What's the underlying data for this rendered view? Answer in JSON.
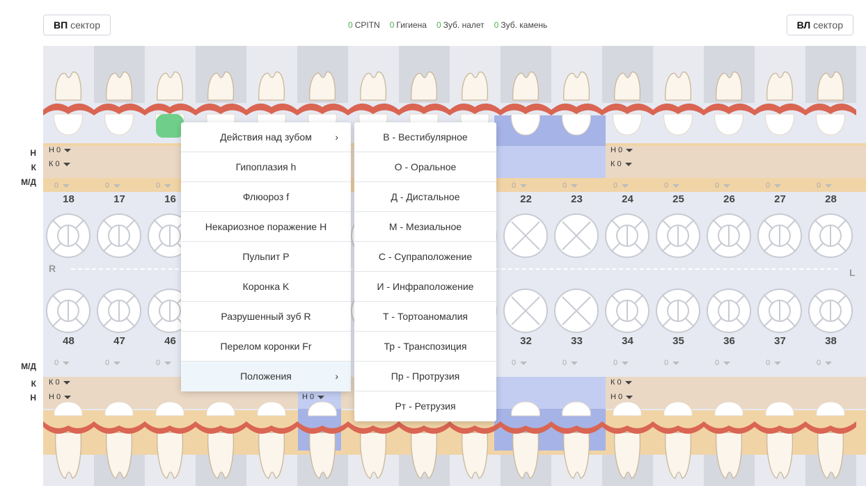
{
  "header": {
    "left_button": {
      "bold": "ВП",
      "text": "сектор"
    },
    "right_button": {
      "bold": "ВЛ",
      "text": "сектор"
    },
    "indicators": [
      {
        "count": "0",
        "label": "CPITN"
      },
      {
        "count": "0",
        "label": "Гигиена"
      },
      {
        "count": "0",
        "label": "Зуб. налет"
      },
      {
        "count": "0",
        "label": "Зуб. камень"
      }
    ]
  },
  "row_labels": {
    "upper_h": "Н",
    "upper_k": "К",
    "upper_md": "М/Д",
    "lower_md": "М/Д",
    "lower_k": "К",
    "lower_h": "Н"
  },
  "upper_numbers": [
    "18",
    "17",
    "16",
    "",
    "",
    "",
    "",
    "",
    "",
    "22",
    "23",
    "24",
    "25",
    "26",
    "27",
    "28"
  ],
  "lower_numbers": [
    "48",
    "47",
    "46",
    "",
    "",
    "",
    "",
    "",
    "",
    "32",
    "33",
    "34",
    "35",
    "36",
    "37",
    "38"
  ],
  "side_labels": {
    "right": "R",
    "left": "L"
  },
  "selectors": {
    "h0": "Н 0",
    "k0": "К 0",
    "md0": "0"
  },
  "context_menu": {
    "items": [
      {
        "label": "Действия над зубом",
        "arrow": "›"
      },
      {
        "label": "Гипоплазия h"
      },
      {
        "label": "Флюороз f"
      },
      {
        "label": "Некариозное поражение H"
      },
      {
        "label": "Пульпит P"
      },
      {
        "label": "Коронка K"
      },
      {
        "label": "Разрушенный зуб R"
      },
      {
        "label": "Перелом коронки Fr"
      },
      {
        "label": "Положения",
        "arrow": "›"
      }
    ]
  },
  "submenu": {
    "items": [
      "В - Вестибулярное",
      "О - Оральное",
      "Д - Дистальное",
      "М - Мезиальное",
      "С - Супраположение",
      "И - Инфраположение",
      "Т - Тортоаномалия",
      "Тр - Транспозиция",
      "Пр - Протрузия",
      "Рт - Ретрузия"
    ]
  },
  "colors": {
    "gum": "#f1d4a6",
    "gum_line": "#d96552",
    "highlight_blue": "#a6b3e6",
    "green_marker": "#6fcf8a",
    "indicator_green": "#4caf50"
  }
}
